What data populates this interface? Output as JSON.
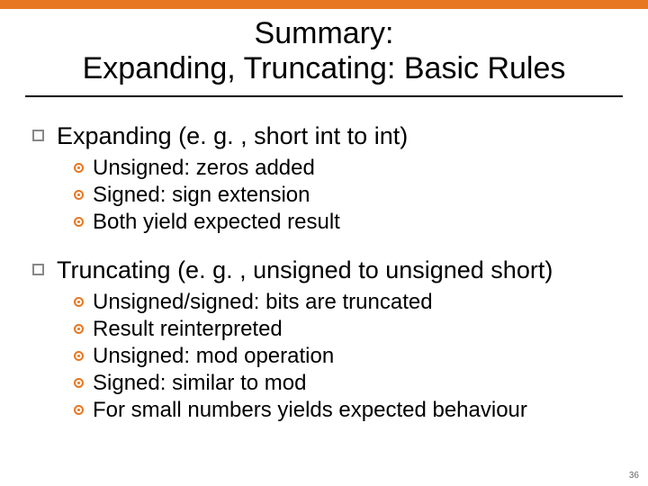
{
  "title": {
    "line1": "Summary:",
    "line2": "Expanding, Truncating: Basic Rules"
  },
  "sections": [
    {
      "heading": "Expanding (e. g. , short int to int)",
      "items": [
        "Unsigned: zeros added",
        "Signed: sign extension",
        "Both yield expected result"
      ]
    },
    {
      "heading": "Truncating (e. g. , unsigned to unsigned short)",
      "items": [
        "Unsigned/signed: bits are truncated",
        "Result reinterpreted",
        "Unsigned: mod operation",
        "Signed: similar to mod",
        "For small numbers yields expected behaviour"
      ]
    }
  ],
  "pageNumber": "36",
  "colors": {
    "accent": "#e87722"
  }
}
